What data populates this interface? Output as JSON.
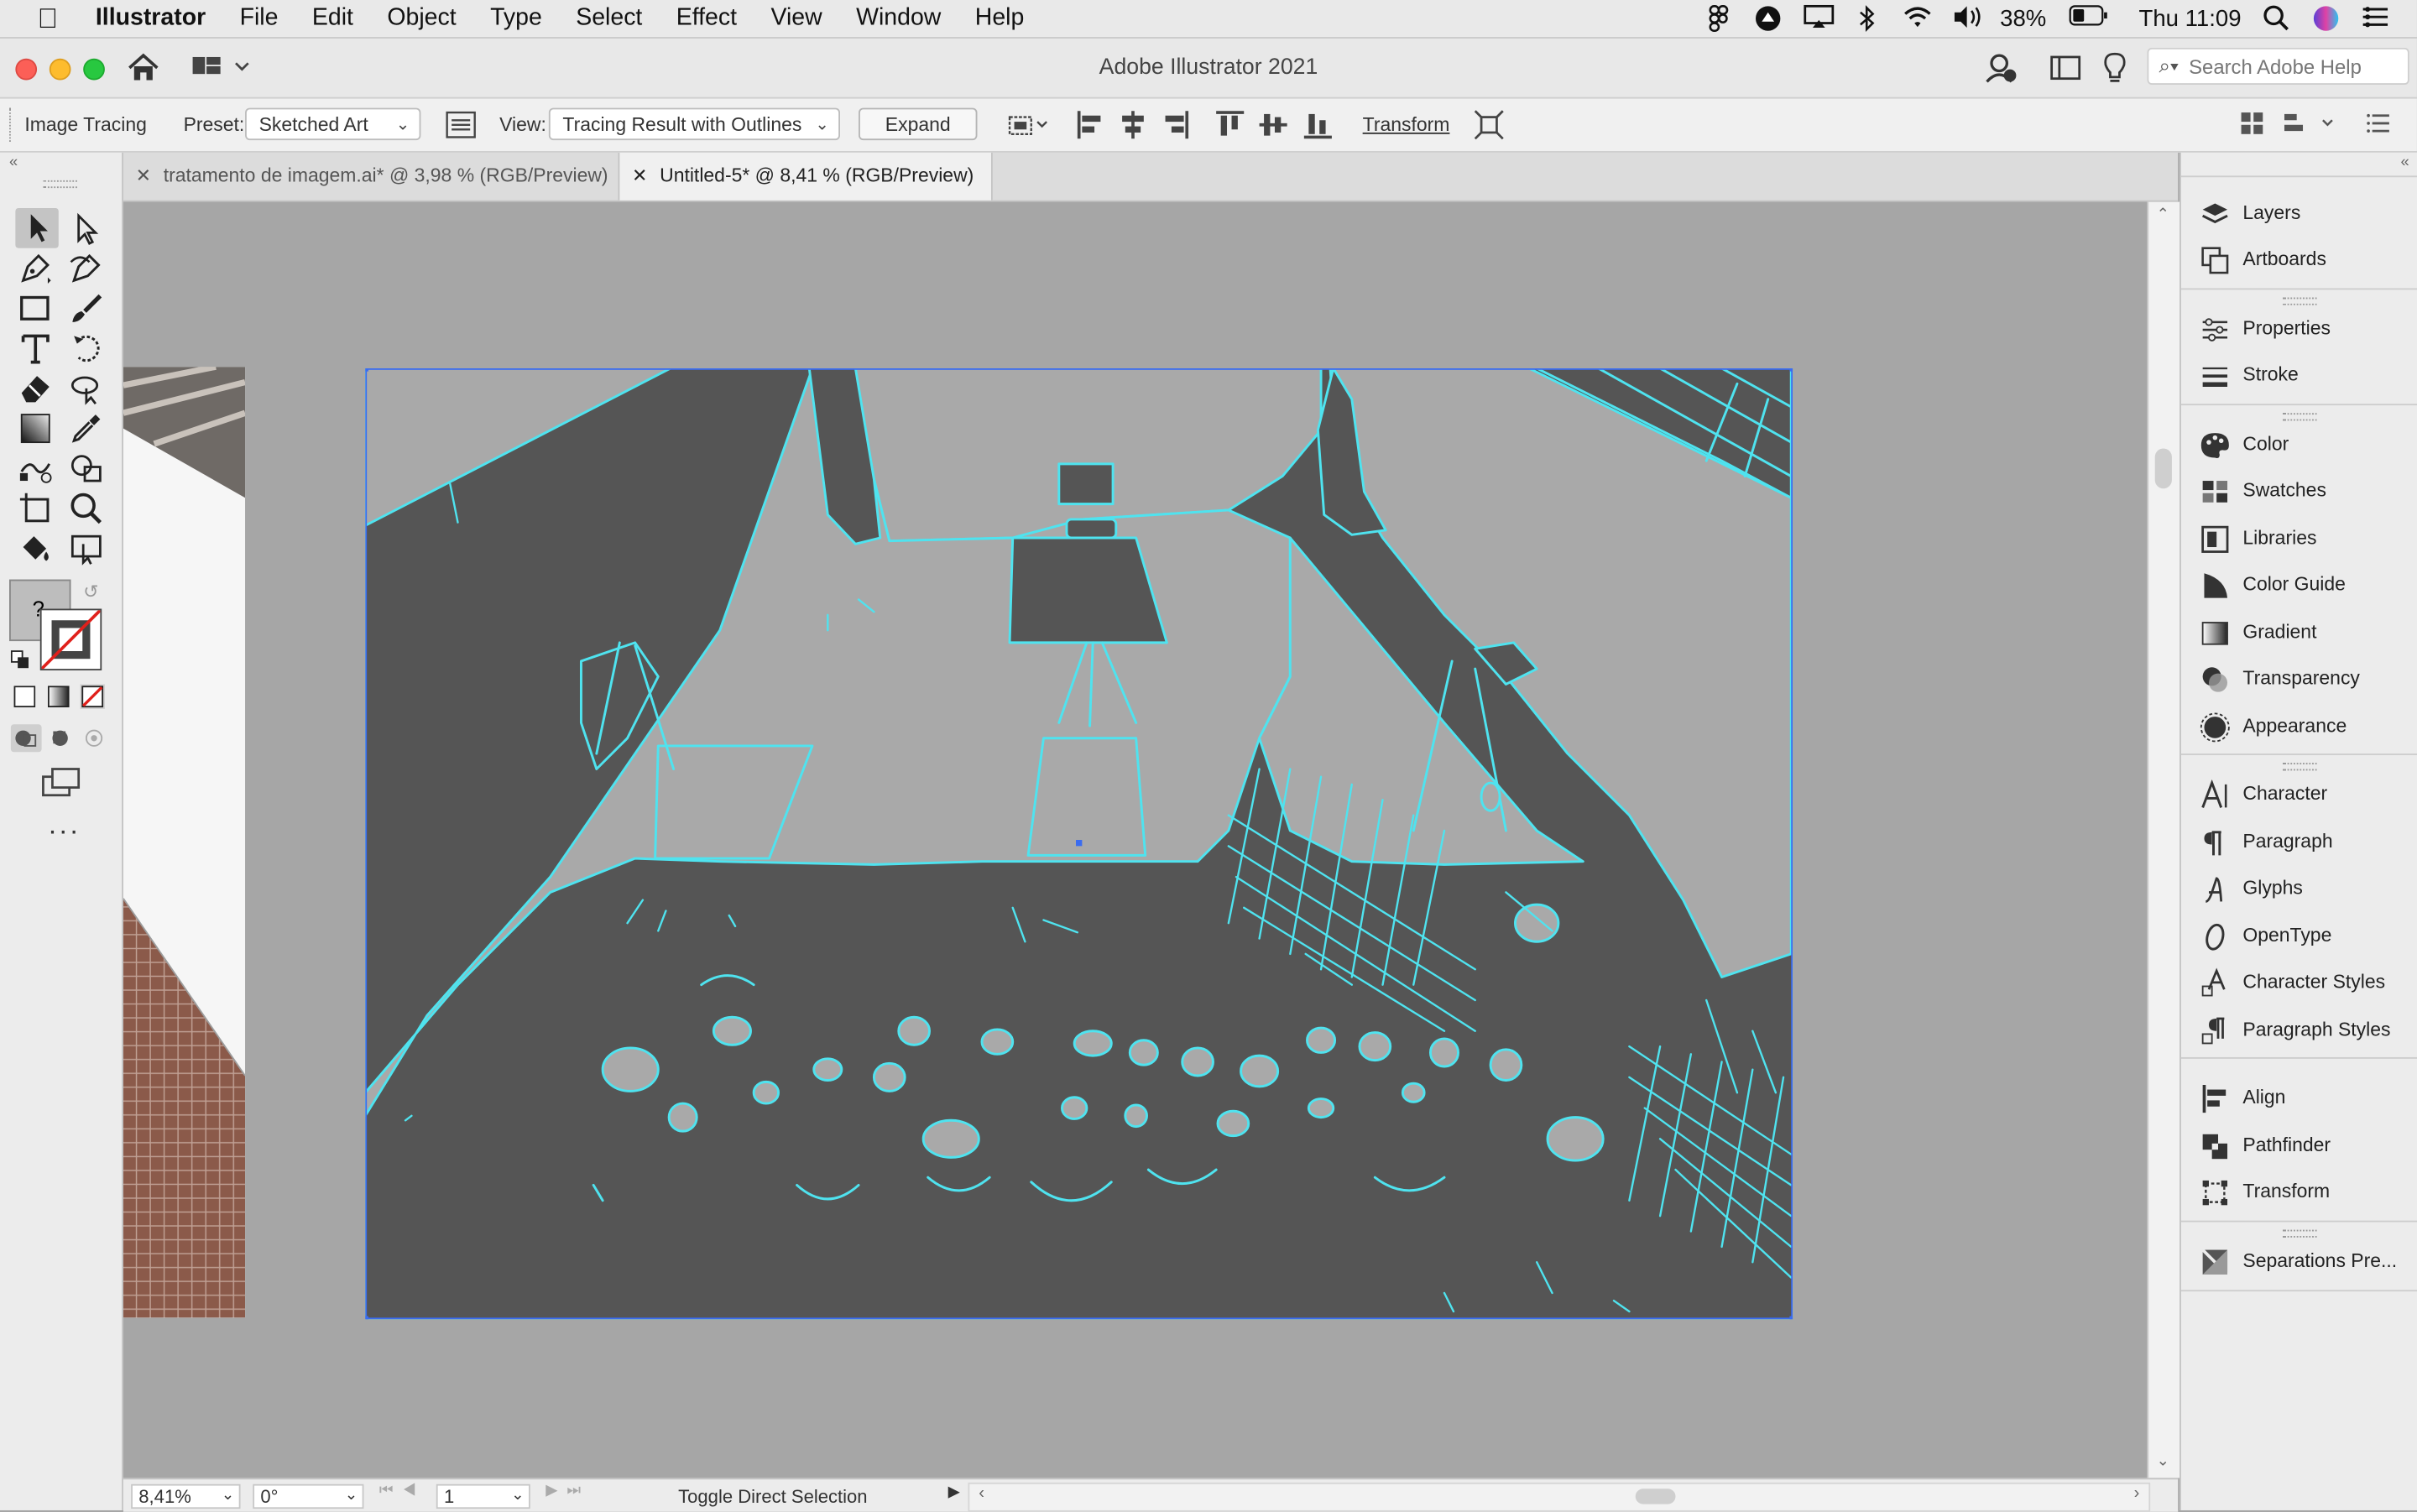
{
  "menubar": {
    "app_name": "Illustrator",
    "menus": [
      "File",
      "Edit",
      "Object",
      "Type",
      "Select",
      "Effect",
      "View",
      "Window",
      "Help"
    ],
    "battery": "38%",
    "clock": "Thu 11:09"
  },
  "window": {
    "title": "Adobe Illustrator 2021",
    "search_placeholder": "Search Adobe Help"
  },
  "control_bar": {
    "panel_label": "Image Tracing",
    "preset_label": "Preset:",
    "preset_value": "Sketched Art",
    "view_label": "View:",
    "view_value": "Tracing Result with Outlines",
    "expand_label": "Expand",
    "transform_label": "Transform"
  },
  "tabs": [
    {
      "title": "tratamento de imagem.ai* @ 3,98 % (RGB/Preview)",
      "active": false
    },
    {
      "title": "Untitled-5* @ 8,41 % (RGB/Preview)",
      "active": true
    }
  ],
  "status_bar": {
    "zoom": "8,41%",
    "rotation": "0°",
    "artboard_number": "1",
    "status_text": "Toggle Direct Selection"
  },
  "panels": [
    {
      "label": "Layers",
      "icon": "layers-icon"
    },
    {
      "label": "Artboards",
      "icon": "artboards-icon"
    },
    {
      "label": "Properties",
      "icon": "properties-icon"
    },
    {
      "label": "Stroke",
      "icon": "stroke-icon"
    },
    {
      "label": "Color",
      "icon": "color-palette-icon"
    },
    {
      "label": "Swatches",
      "icon": "swatches-icon"
    },
    {
      "label": "Libraries",
      "icon": "libraries-icon"
    },
    {
      "label": "Color Guide",
      "icon": "color-guide-icon"
    },
    {
      "label": "Gradient",
      "icon": "gradient-icon"
    },
    {
      "label": "Transparency",
      "icon": "transparency-icon"
    },
    {
      "label": "Appearance",
      "icon": "appearance-icon"
    },
    {
      "label": "Character",
      "icon": "character-icon"
    },
    {
      "label": "Paragraph",
      "icon": "paragraph-icon"
    },
    {
      "label": "Glyphs",
      "icon": "glyphs-icon"
    },
    {
      "label": "OpenType",
      "icon": "opentype-icon"
    },
    {
      "label": "Character Styles",
      "icon": "character-styles-icon"
    },
    {
      "label": "Paragraph Styles",
      "icon": "paragraph-styles-icon"
    },
    {
      "label": "Align",
      "icon": "align-icon"
    },
    {
      "label": "Pathfinder",
      "icon": "pathfinder-icon"
    },
    {
      "label": "Transform",
      "icon": "transform-icon"
    },
    {
      "label": "Separations Pre...",
      "icon": "separations-icon"
    }
  ],
  "colors": {
    "trace_outline": "#4fe3ef",
    "trace_fill_dark": "#555555",
    "trace_fill_light": "#a9a9a9",
    "selection_blue": "#3b6cf0"
  }
}
